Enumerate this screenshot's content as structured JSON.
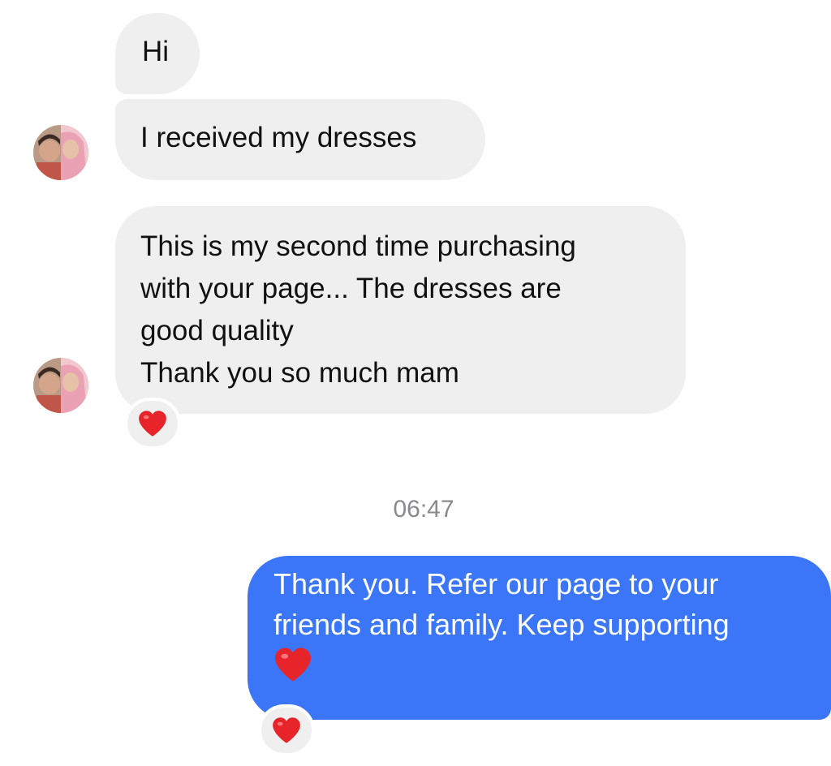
{
  "conversation": {
    "incoming": [
      {
        "lines": [
          "Hi"
        ]
      },
      {
        "lines": [
          "I received my dresses"
        ]
      },
      {
        "lines": [
          "This is my second time purchasing",
          "with your page... The dresses are",
          "good quality",
          "Thank you so much mam"
        ],
        "reaction": "heart-icon"
      }
    ],
    "timestamp": "06:47",
    "outgoing": [
      {
        "lines": [
          "Thank you. Refer our page to your",
          "friends and family. Keep supporting"
        ],
        "emoji": "heart-icon",
        "reaction": "heart-icon"
      }
    ]
  },
  "colors": {
    "incoming_bubble": "#efefef",
    "outgoing_bubble": "#3a76f7",
    "timestamp_text": "#8a8a8e",
    "heart": "#e8242b"
  }
}
